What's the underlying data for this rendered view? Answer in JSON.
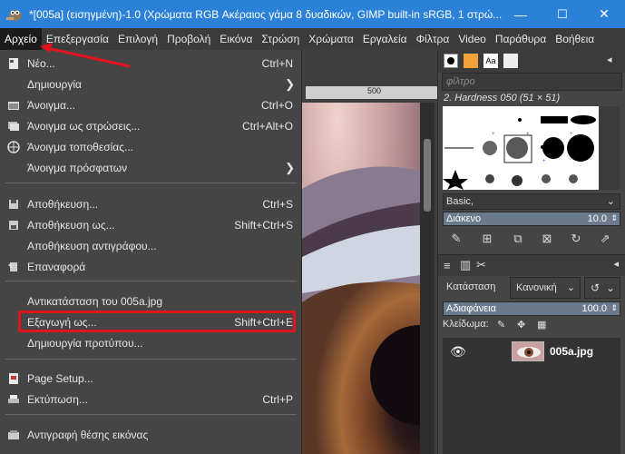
{
  "window": {
    "title": "*[005a] (εισηγμένη)-1.0 (Χρώματα RGB Ακέραιος γάμα 8 δυαδικών, GIMP built-in sRGB, 1 στρώ...",
    "minimize": "—",
    "maximize": "☐",
    "close": "✕"
  },
  "menubar": [
    "Αρχείο",
    "Επεξεργασία",
    "Επιλογή",
    "Προβολή",
    "Εικόνα",
    "Στρώση",
    "Χρώματα",
    "Εργαλεία",
    "Φίλτρα",
    "Video",
    "Παράθυρα",
    "Βοήθεια"
  ],
  "ruler": {
    "mark": "500"
  },
  "file_menu": {
    "items": [
      {
        "label": "Νέο...",
        "shortcut": "Ctrl+N",
        "icon": "new-file-icon"
      },
      {
        "label": "Δημιουργία",
        "shortcut": "",
        "icon": "",
        "submenu": true
      },
      {
        "label": "Άνοιγμα...",
        "shortcut": "Ctrl+O",
        "icon": "open-icon"
      },
      {
        "label": "Άνοιγμα ως στρώσεις...",
        "shortcut": "Ctrl+Alt+O",
        "icon": "open-layers-icon"
      },
      {
        "label": "Άνοιγμα τοποθεσίας...",
        "shortcut": "",
        "icon": "globe-icon"
      },
      {
        "label": "Άνοιγμα πρόσφατων",
        "shortcut": "",
        "icon": "",
        "submenu": true
      },
      {
        "label": "Αποθήκευση...",
        "shortcut": "Ctrl+S",
        "icon": "save-icon"
      },
      {
        "label": "Αποθήκευση ως...",
        "shortcut": "Shift+Ctrl+S",
        "icon": "save-as-icon"
      },
      {
        "label": "Αποθήκευση αντιγράφου...",
        "shortcut": "",
        "icon": ""
      },
      {
        "label": "Επαναφορά",
        "shortcut": "",
        "icon": "revert-icon"
      },
      {
        "label": "Αντικατάσταση του 005a.jpg",
        "shortcut": "",
        "icon": ""
      },
      {
        "label": "Εξαγωγή ως...",
        "shortcut": "Shift+Ctrl+E",
        "icon": ""
      },
      {
        "label": "Δημιουργία προτύπου...",
        "shortcut": "",
        "icon": ""
      },
      {
        "label": "Page Setup...",
        "shortcut": "",
        "icon": "page-setup-icon"
      },
      {
        "label": "Εκτύπωση...",
        "shortcut": "Ctrl+P",
        "icon": "print-icon"
      },
      {
        "label": "Αντιγραφή θέσης εικόνας",
        "shortcut": "",
        "icon": "copy-location-icon"
      }
    ],
    "submenu_arrow": "❯"
  },
  "brushes": {
    "filter_placeholder": "φίλτρο",
    "current": "2. Hardness 050 (51 × 51)",
    "preset": "Basic,",
    "spacing_label": "Διάκενο",
    "spacing_value": "10.0"
  },
  "layers": {
    "mode_label": "Κατάσταση",
    "mode_value": "Κανονική",
    "opacity_label": "Αδιαφάνεια",
    "opacity_value": "100.0",
    "lock_label": "Κλείδωμα:",
    "layer_name": "005a.jpg"
  },
  "colors": {
    "titlebar": "#2b80d8",
    "highlight": "#e1141e",
    "menu_bg": "#454545"
  }
}
